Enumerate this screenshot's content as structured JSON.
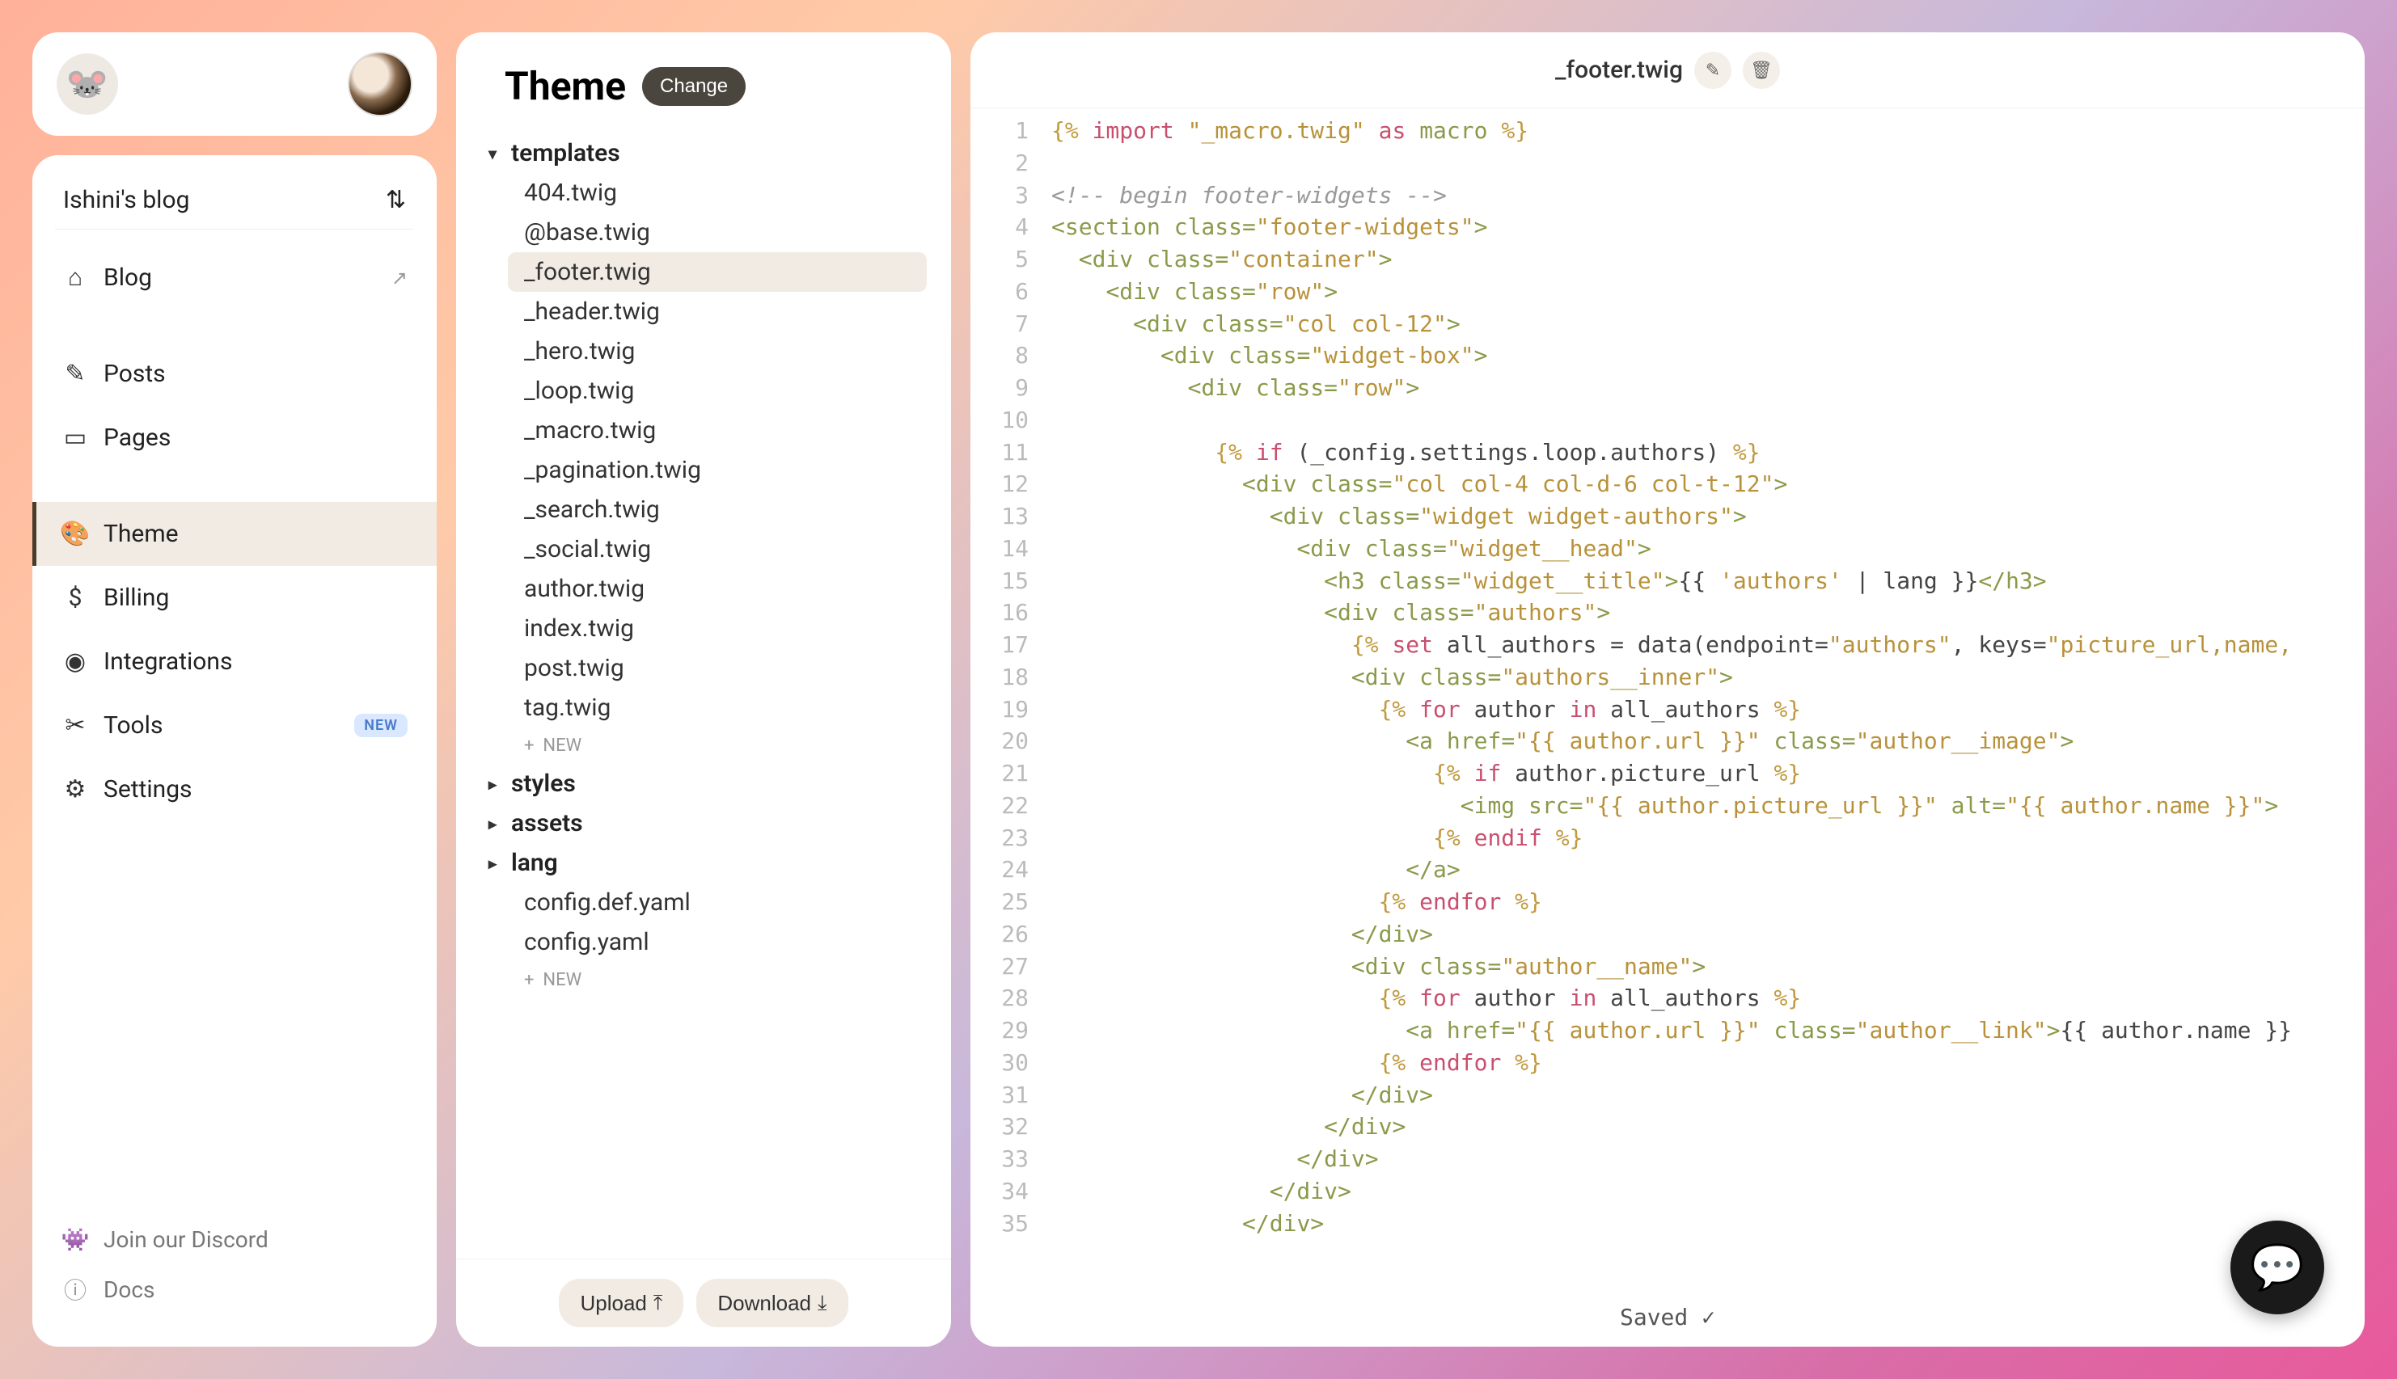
{
  "blog_name": "Ishini's blog",
  "nav": {
    "blog": "Blog",
    "posts": "Posts",
    "pages": "Pages",
    "theme": "Theme",
    "billing": "Billing",
    "integrations": "Integrations",
    "tools": "Tools",
    "tools_badge": "NEW",
    "settings": "Settings",
    "discord": "Join our Discord",
    "docs": "Docs"
  },
  "tree": {
    "title": "Theme",
    "change_label": "Change",
    "folders": {
      "templates": "templates",
      "styles": "styles",
      "assets": "assets",
      "lang": "lang"
    },
    "templates_files": [
      "404.twig",
      "@base.twig",
      "_footer.twig",
      "_header.twig",
      "_hero.twig",
      "_loop.twig",
      "_macro.twig",
      "_pagination.twig",
      "_search.twig",
      "_social.twig",
      "author.twig",
      "index.twig",
      "post.twig",
      "tag.twig"
    ],
    "root_files": [
      "config.def.yaml",
      "config.yaml"
    ],
    "new_label": "NEW",
    "upload_label": "Upload",
    "download_label": "Download"
  },
  "editor": {
    "filename": "_footer.twig",
    "saved_label": "Saved"
  },
  "code_lines": [
    [
      [
        "delim",
        "{% "
      ],
      [
        "kw",
        "import"
      ],
      [
        "plain",
        " "
      ],
      [
        "str",
        "\"_macro.twig\""
      ],
      [
        "plain",
        " "
      ],
      [
        "kw",
        "as"
      ],
      [
        "plain",
        " "
      ],
      [
        "tag",
        "macro"
      ],
      [
        "delim",
        " %}"
      ]
    ],
    [],
    [
      [
        "comment",
        "<!-- begin footer-widgets -->"
      ]
    ],
    [
      [
        "tag",
        "<section "
      ],
      [
        "attr",
        "class"
      ],
      [
        "tag",
        "="
      ],
      [
        "str",
        "\"footer-widgets\""
      ],
      [
        "tag",
        ">"
      ]
    ],
    [
      [
        "plain",
        "  "
      ],
      [
        "tag",
        "<div "
      ],
      [
        "attr",
        "class"
      ],
      [
        "tag",
        "="
      ],
      [
        "str",
        "\"container\""
      ],
      [
        "tag",
        ">"
      ]
    ],
    [
      [
        "plain",
        "    "
      ],
      [
        "tag",
        "<div "
      ],
      [
        "attr",
        "class"
      ],
      [
        "tag",
        "="
      ],
      [
        "str",
        "\"row\""
      ],
      [
        "tag",
        ">"
      ]
    ],
    [
      [
        "plain",
        "      "
      ],
      [
        "tag",
        "<div "
      ],
      [
        "attr",
        "class"
      ],
      [
        "tag",
        "="
      ],
      [
        "str",
        "\"col col-12\""
      ],
      [
        "tag",
        ">"
      ]
    ],
    [
      [
        "plain",
        "        "
      ],
      [
        "tag",
        "<div "
      ],
      [
        "attr",
        "class"
      ],
      [
        "tag",
        "="
      ],
      [
        "str",
        "\"widget-box\""
      ],
      [
        "tag",
        ">"
      ]
    ],
    [
      [
        "plain",
        "          "
      ],
      [
        "tag",
        "<div "
      ],
      [
        "attr",
        "class"
      ],
      [
        "tag",
        "="
      ],
      [
        "str",
        "\"row\""
      ],
      [
        "tag",
        ">"
      ]
    ],
    [],
    [
      [
        "plain",
        "            "
      ],
      [
        "delim",
        "{% "
      ],
      [
        "kw",
        "if"
      ],
      [
        "plain",
        " (_config.settings.loop.authors) "
      ],
      [
        "delim",
        "%}"
      ]
    ],
    [
      [
        "plain",
        "              "
      ],
      [
        "tag",
        "<div "
      ],
      [
        "attr",
        "class"
      ],
      [
        "tag",
        "="
      ],
      [
        "str",
        "\"col col-4 col-d-6 col-t-12\""
      ],
      [
        "tag",
        ">"
      ]
    ],
    [
      [
        "plain",
        "                "
      ],
      [
        "tag",
        "<div "
      ],
      [
        "attr",
        "class"
      ],
      [
        "tag",
        "="
      ],
      [
        "str",
        "\"widget widget-authors\""
      ],
      [
        "tag",
        ">"
      ]
    ],
    [
      [
        "plain",
        "                  "
      ],
      [
        "tag",
        "<div "
      ],
      [
        "attr",
        "class"
      ],
      [
        "tag",
        "="
      ],
      [
        "str",
        "\"widget__head\""
      ],
      [
        "tag",
        ">"
      ]
    ],
    [
      [
        "plain",
        "                    "
      ],
      [
        "tag",
        "<h3 "
      ],
      [
        "attr",
        "class"
      ],
      [
        "tag",
        "="
      ],
      [
        "str",
        "\"widget__title\""
      ],
      [
        "tag",
        ">"
      ],
      [
        "plain",
        "{{ "
      ],
      [
        "str",
        "'authors'"
      ],
      [
        "plain",
        " | lang }}"
      ],
      [
        "tag",
        "</h3>"
      ]
    ],
    [
      [
        "plain",
        "                    "
      ],
      [
        "tag",
        "<div "
      ],
      [
        "attr",
        "class"
      ],
      [
        "tag",
        "="
      ],
      [
        "str",
        "\"authors\""
      ],
      [
        "tag",
        ">"
      ]
    ],
    [
      [
        "plain",
        "                      "
      ],
      [
        "delim",
        "{% "
      ],
      [
        "kw",
        "set"
      ],
      [
        "plain",
        " all_authors = data(endpoint="
      ],
      [
        "str",
        "\"authors\""
      ],
      [
        "plain",
        ", keys="
      ],
      [
        "str",
        "\"picture_url,name,"
      ]
    ],
    [
      [
        "plain",
        "                      "
      ],
      [
        "tag",
        "<div "
      ],
      [
        "attr",
        "class"
      ],
      [
        "tag",
        "="
      ],
      [
        "str",
        "\"authors__inner\""
      ],
      [
        "tag",
        ">"
      ]
    ],
    [
      [
        "plain",
        "                        "
      ],
      [
        "delim",
        "{% "
      ],
      [
        "kw",
        "for"
      ],
      [
        "plain",
        " author "
      ],
      [
        "kw",
        "in"
      ],
      [
        "plain",
        " all_authors "
      ],
      [
        "delim",
        "%}"
      ]
    ],
    [
      [
        "plain",
        "                          "
      ],
      [
        "tag",
        "<a "
      ],
      [
        "attr",
        "href"
      ],
      [
        "tag",
        "="
      ],
      [
        "str",
        "\"{{ author.url }}\""
      ],
      [
        "tag",
        " "
      ],
      [
        "attr",
        "class"
      ],
      [
        "tag",
        "="
      ],
      [
        "str",
        "\"author__image\""
      ],
      [
        "tag",
        ">"
      ]
    ],
    [
      [
        "plain",
        "                            "
      ],
      [
        "delim",
        "{% "
      ],
      [
        "kw",
        "if"
      ],
      [
        "plain",
        " author.picture_url "
      ],
      [
        "delim",
        "%}"
      ]
    ],
    [
      [
        "plain",
        "                              "
      ],
      [
        "tag",
        "<img "
      ],
      [
        "attr",
        "src"
      ],
      [
        "tag",
        "="
      ],
      [
        "str",
        "\"{{ author.picture_url }}\""
      ],
      [
        "tag",
        " "
      ],
      [
        "attr",
        "alt"
      ],
      [
        "tag",
        "="
      ],
      [
        "str",
        "\"{{ author.name }}\""
      ],
      [
        "tag",
        ">"
      ]
    ],
    [
      [
        "plain",
        "                            "
      ],
      [
        "delim",
        "{% "
      ],
      [
        "kw",
        "endif"
      ],
      [
        "delim",
        " %}"
      ]
    ],
    [
      [
        "plain",
        "                          "
      ],
      [
        "tag",
        "</a>"
      ]
    ],
    [
      [
        "plain",
        "                        "
      ],
      [
        "delim",
        "{% "
      ],
      [
        "kw",
        "endfor"
      ],
      [
        "delim",
        " %}"
      ]
    ],
    [
      [
        "plain",
        "                      "
      ],
      [
        "tag",
        "</div>"
      ]
    ],
    [
      [
        "plain",
        "                      "
      ],
      [
        "tag",
        "<div "
      ],
      [
        "attr",
        "class"
      ],
      [
        "tag",
        "="
      ],
      [
        "str",
        "\"author__name\""
      ],
      [
        "tag",
        ">"
      ]
    ],
    [
      [
        "plain",
        "                        "
      ],
      [
        "delim",
        "{% "
      ],
      [
        "kw",
        "for"
      ],
      [
        "plain",
        " author "
      ],
      [
        "kw",
        "in"
      ],
      [
        "plain",
        " all_authors "
      ],
      [
        "delim",
        "%}"
      ]
    ],
    [
      [
        "plain",
        "                          "
      ],
      [
        "tag",
        "<a "
      ],
      [
        "attr",
        "href"
      ],
      [
        "tag",
        "="
      ],
      [
        "str",
        "\"{{ author.url }}\""
      ],
      [
        "tag",
        " "
      ],
      [
        "attr",
        "class"
      ],
      [
        "tag",
        "="
      ],
      [
        "str",
        "\"author__link\""
      ],
      [
        "tag",
        ">"
      ],
      [
        "plain",
        "{{ author.name }}"
      ]
    ],
    [
      [
        "plain",
        "                        "
      ],
      [
        "delim",
        "{% "
      ],
      [
        "kw",
        "endfor"
      ],
      [
        "delim",
        " %}"
      ]
    ],
    [
      [
        "plain",
        "                      "
      ],
      [
        "tag",
        "</div>"
      ]
    ],
    [
      [
        "plain",
        "                    "
      ],
      [
        "tag",
        "</div>"
      ]
    ],
    [
      [
        "plain",
        "                  "
      ],
      [
        "tag",
        "</div>"
      ]
    ],
    [
      [
        "plain",
        "                "
      ],
      [
        "tag",
        "</div>"
      ]
    ],
    [
      [
        "plain",
        "              "
      ],
      [
        "tag",
        "</div>"
      ]
    ]
  ]
}
